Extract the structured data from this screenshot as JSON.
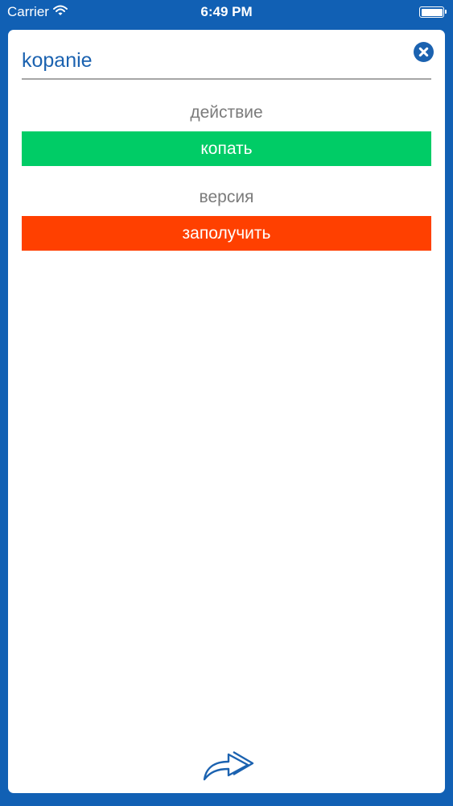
{
  "status_bar": {
    "carrier": "Carrier",
    "time": "6:49 PM"
  },
  "search": {
    "value": "kopanie"
  },
  "results": [
    {
      "label": "действие",
      "translation": "копать",
      "color": "#00cc66"
    },
    {
      "label": "версия",
      "translation": "заполучить",
      "color": "#ff4000"
    }
  ],
  "icons": {
    "clear": "close-circle-icon",
    "share": "share-arrow-icon"
  }
}
